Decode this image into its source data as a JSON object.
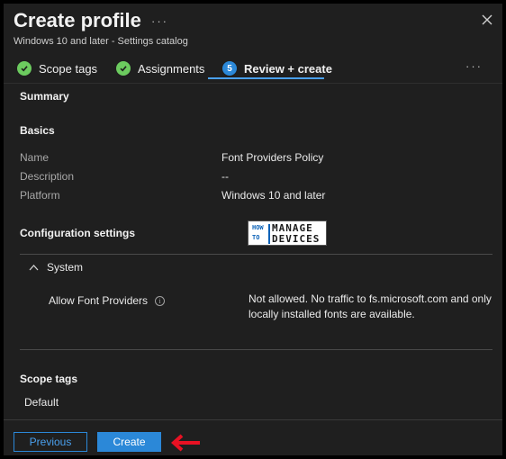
{
  "header": {
    "title": "Create profile",
    "more": "···",
    "subtitle": "Windows 10 and later - Settings catalog"
  },
  "steps": [
    {
      "label": "Scope tags",
      "state": "complete"
    },
    {
      "label": "Assignments",
      "state": "complete"
    },
    {
      "label": "Review + create",
      "state": "active",
      "number": "5"
    }
  ],
  "steps_more": "···",
  "summary": {
    "heading": "Summary",
    "basics_heading": "Basics",
    "basics": [
      {
        "label": "Name",
        "value": "Font Providers Policy"
      },
      {
        "label": "Description",
        "value": "--"
      },
      {
        "label": "Platform",
        "value": "Windows 10 and later"
      }
    ],
    "config_heading": "Configuration settings",
    "logo": {
      "left_top": "HOW",
      "left_bottom": "TO",
      "right_top": "MANAGE",
      "right_bottom": "DEVICES"
    },
    "group": "System",
    "setting_name": "Allow Font Providers",
    "info_glyph": "i",
    "setting_value": "Not allowed. No traffic to fs.microsoft.com and only locally installed fonts are available.",
    "scope_heading": "Scope tags",
    "scope_value": "Default"
  },
  "footer": {
    "previous_label": "Previous",
    "create_label": "Create"
  },
  "colors": {
    "background": "#1f1f1f",
    "accent": "#2b88d8",
    "success": "#6ccb5f",
    "annotation_arrow": "#e81123"
  }
}
